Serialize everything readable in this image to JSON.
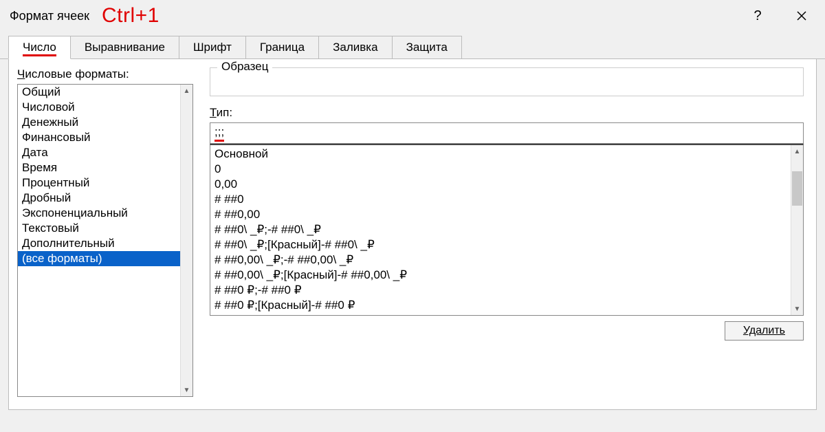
{
  "dialog": {
    "title": "Формат ячеек",
    "shortcut_annotation": "Ctrl+1"
  },
  "tabs": {
    "items": [
      {
        "label": "Число",
        "active": true
      },
      {
        "label": "Выравнивание",
        "active": false
      },
      {
        "label": "Шрифт",
        "active": false
      },
      {
        "label": "Граница",
        "active": false
      },
      {
        "label": "Заливка",
        "active": false
      },
      {
        "label": "Защита",
        "active": false
      }
    ]
  },
  "left": {
    "label_prefix": "Ч",
    "label_rest": "исловые форматы:",
    "categories": [
      "Общий",
      "Числовой",
      "Денежный",
      "Финансовый",
      "Дата",
      "Время",
      "Процентный",
      "Дробный",
      "Экспоненциальный",
      "Текстовый",
      "Дополнительный",
      "(все форматы)"
    ],
    "selected_index": 11
  },
  "right": {
    "sample_label": "Образец",
    "type_label_prefix": "Т",
    "type_label_rest": "ип:",
    "type_value": ";;;",
    "type_options": [
      "Основной",
      "0",
      "0,00",
      "# ##0",
      "# ##0,00",
      "# ##0\\ _₽;-# ##0\\ _₽",
      "# ##0\\ _₽;[Красный]-# ##0\\ _₽",
      "# ##0,00\\ _₽;-# ##0,00\\ _₽",
      "# ##0,00\\ _₽;[Красный]-# ##0,00\\ _₽",
      "# ##0 ₽;-# ##0 ₽",
      "# ##0 ₽;[Красный]-# ##0 ₽"
    ],
    "delete_button": "Удалить"
  }
}
